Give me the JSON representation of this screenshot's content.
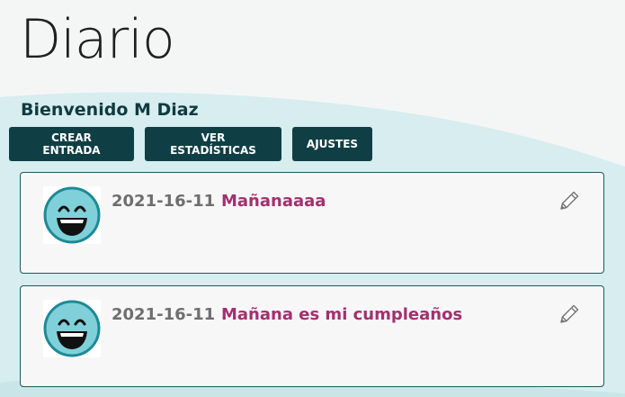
{
  "header": {
    "title": "Diario",
    "welcome": "Bienvenido M Diaz"
  },
  "toolbar": {
    "create_label": "CREAR ENTRADA",
    "stats_label": "VER ESTADÍSTICAS",
    "settings_label": "AJUSTES"
  },
  "entries": [
    {
      "date": "2021-16-11",
      "title": "Mañanaaaa",
      "mood_icon": "laughing-face-icon"
    },
    {
      "date": "2021-16-11",
      "title": "Mañana es mi cumpleaños",
      "mood_icon": "laughing-face-icon"
    }
  ],
  "colors": {
    "button_bg": "#0f3f44",
    "entry_title": "#a3306f",
    "entry_border": "#1b5a5e",
    "wave": "#d6ecef"
  }
}
